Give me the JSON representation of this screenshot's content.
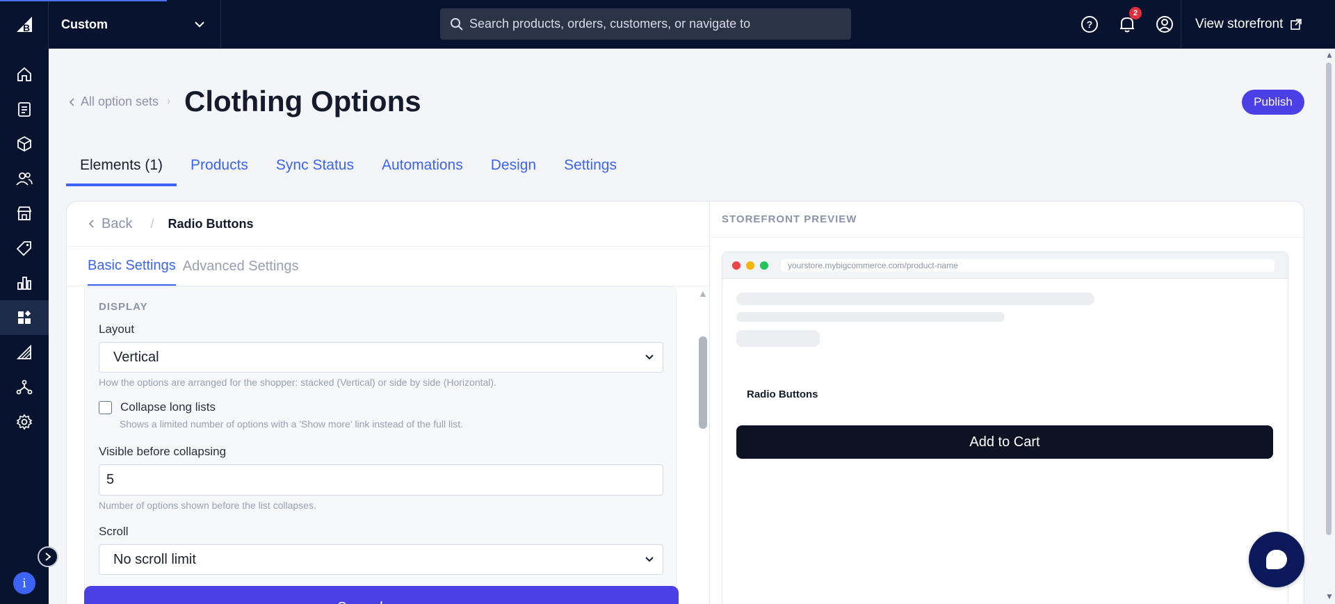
{
  "topbar": {
    "store_name": "Custom",
    "search_placeholder": "Search products, orders, customers, or navigate to",
    "notification_count": "2",
    "view_storefront": "View storefront"
  },
  "sidebar": {
    "items": [
      {
        "name": "home-icon"
      },
      {
        "name": "orders-icon"
      },
      {
        "name": "products-icon"
      },
      {
        "name": "customers-icon"
      },
      {
        "name": "storefront-icon"
      },
      {
        "name": "marketing-icon"
      },
      {
        "name": "analytics-icon"
      },
      {
        "name": "apps-icon",
        "active": true
      },
      {
        "name": "channel-manager-icon"
      },
      {
        "name": "channels-icon"
      },
      {
        "name": "settings-icon"
      }
    ],
    "info_glyph": "i"
  },
  "header": {
    "back_label": "All option sets",
    "title": "Clothing Options",
    "publish": "Publish"
  },
  "tabs": [
    {
      "label": "Elements (1)",
      "active": true
    },
    {
      "label": "Products"
    },
    {
      "label": "Sync Status"
    },
    {
      "label": "Automations"
    },
    {
      "label": "Design"
    },
    {
      "label": "Settings"
    }
  ],
  "editor": {
    "back": "Back",
    "current": "Radio Buttons",
    "subtabs": [
      "Basic Settings",
      "Advanced Settings"
    ],
    "section": "DISPLAY",
    "layout_label": "Layout",
    "layout_value": "Vertical",
    "layout_help": "How the options are arranged for the shopper: stacked (Vertical) or side by side (Horizontal).",
    "collapse_label": "Collapse long lists",
    "collapse_help": "Shows a limited number of options with a 'Show more' link instead of the full list.",
    "visible_label": "Visible before collapsing",
    "visible_value": "5",
    "visible_help": "Number of options shown before the list collapses.",
    "scroll_label": "Scroll",
    "scroll_value": "No scroll limit",
    "save": "Save changes"
  },
  "preview": {
    "label": "STOREFRONT PREVIEW",
    "url": "yourstore.mybigcommerce.com/product-name",
    "element_title": "Radio Buttons",
    "add_to_cart": "Add to Cart"
  },
  "colors": {
    "nav_bg": "#081330",
    "accent": "#3c64f4",
    "primary_button": "#4b3fe6",
    "badge": "#e02f3c"
  }
}
